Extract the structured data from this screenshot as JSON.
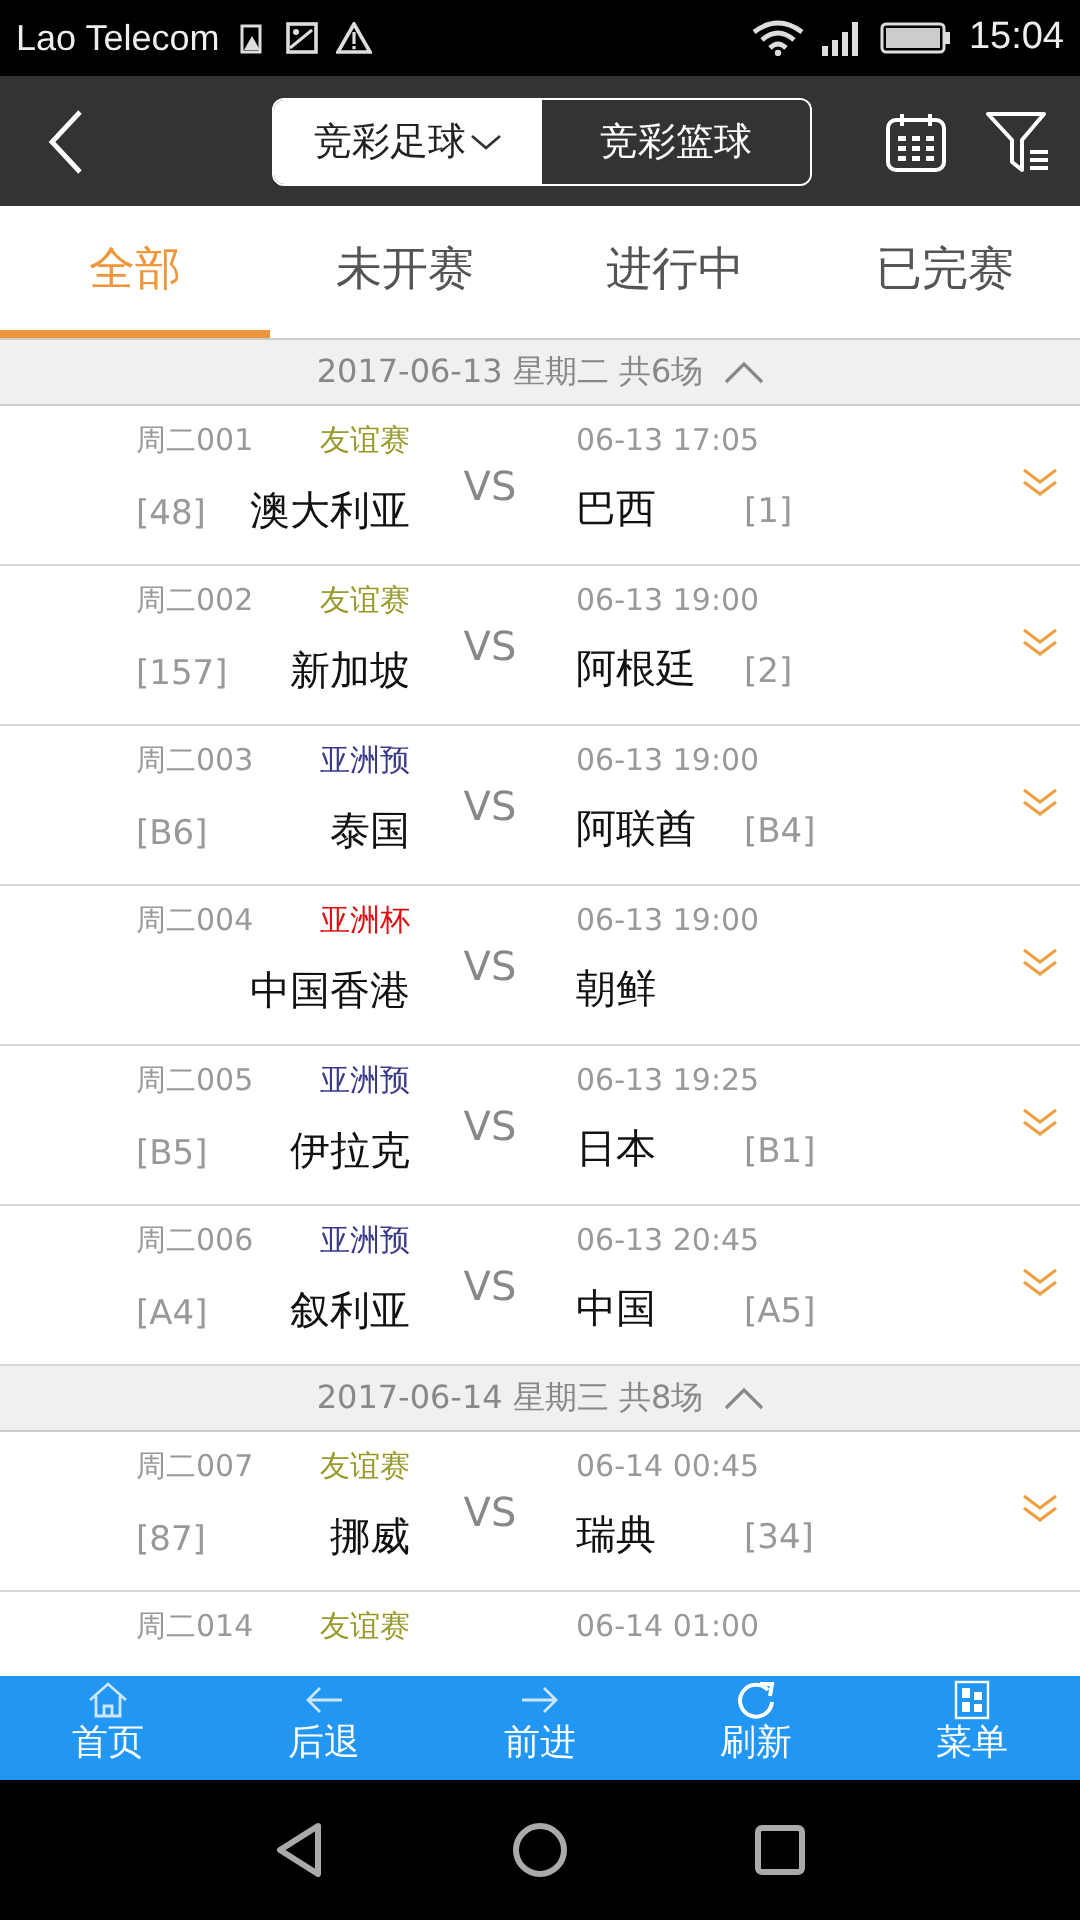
{
  "status_bar": {
    "carrier": "Lao Telecom",
    "time": "15:04"
  },
  "header": {
    "sport_tabs": [
      {
        "label": "竞彩足球",
        "selected": true,
        "dropdown": true
      },
      {
        "label": "竞彩篮球",
        "selected": false,
        "dropdown": false
      }
    ]
  },
  "tabs": [
    {
      "label": "全部",
      "selected": true
    },
    {
      "label": "未开赛",
      "selected": false
    },
    {
      "label": "进行中",
      "selected": false
    },
    {
      "label": "已完赛",
      "selected": false
    }
  ],
  "groups": [
    {
      "title": "2017-06-13 星期二 共6场",
      "expanded": true,
      "matches": [
        {
          "code": "周二001",
          "league": "友谊赛",
          "color": "#9a9a2a",
          "time": "06-13 17:05",
          "home_rank": "[48]",
          "home": "澳大利亚",
          "vs": "VS",
          "away": "巴西",
          "away_rank": "[1]"
        },
        {
          "code": "周二002",
          "league": "友谊赛",
          "color": "#9a9a2a",
          "time": "06-13 19:00",
          "home_rank": "[157]",
          "home": "新加坡",
          "vs": "VS",
          "away": "阿根廷",
          "away_rank": "[2]"
        },
        {
          "code": "周二003",
          "league": "亚洲预",
          "color": "#3a3a8c",
          "time": "06-13 19:00",
          "home_rank": "[B6]",
          "home": "泰国",
          "vs": "VS",
          "away": "阿联酋",
          "away_rank": "[B4]"
        },
        {
          "code": "周二004",
          "league": "亚洲杯",
          "color": "#e01010",
          "time": "06-13 19:00",
          "home": "中国香港",
          "vs": "VS",
          "away": "朝鲜"
        },
        {
          "code": "周二005",
          "league": "亚洲预",
          "color": "#3a3a8c",
          "time": "06-13 19:25",
          "home_rank": "[B5]",
          "home": "伊拉克",
          "vs": "VS",
          "away": "日本",
          "away_rank": "[B1]"
        },
        {
          "code": "周二006",
          "league": "亚洲预",
          "color": "#3a3a8c",
          "time": "06-13 20:45",
          "home_rank": "[A4]",
          "home": "叙利亚",
          "vs": "VS",
          "away": "中国",
          "away_rank": "[A5]"
        }
      ]
    },
    {
      "title": "2017-06-14 星期三 共8场",
      "expanded": true,
      "matches": [
        {
          "code": "周二007",
          "league": "友谊赛",
          "color": "#9a9a2a",
          "time": "06-14 00:45",
          "home_rank": "[87]",
          "home": "挪威",
          "vs": "VS",
          "away": "瑞典",
          "away_rank": "[34]"
        },
        {
          "code": "周二014",
          "league": "友谊赛",
          "color": "#9a9a2a",
          "time": "06-14 01:00"
        }
      ]
    }
  ],
  "bottom_nav": [
    {
      "label": "首页",
      "kind": "home"
    },
    {
      "label": "后退",
      "kind": "back"
    },
    {
      "label": "前进",
      "kind": "forward"
    },
    {
      "label": "刷新",
      "kind": "refresh"
    },
    {
      "label": "菜单",
      "kind": "menu"
    }
  ]
}
